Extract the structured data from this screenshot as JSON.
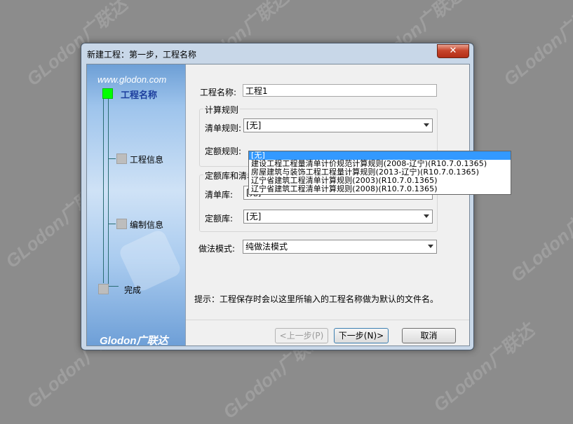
{
  "watermark": {
    "text": "GLodon广联达"
  },
  "dialog": {
    "title": "新建工程：第一步，工程名称",
    "close_symbol": "✕"
  },
  "sidebar": {
    "url": "www.glodon.com",
    "logo": "Glodon广联达",
    "steps": [
      {
        "label": "工程名称",
        "active": true
      },
      {
        "label": "工程信息",
        "active": false
      },
      {
        "label": "编制信息",
        "active": false
      },
      {
        "label": "完成",
        "active": false
      }
    ]
  },
  "form": {
    "project_name_label": "工程名称:",
    "project_name_value": "工程1",
    "calc_rules_group": "计算规则",
    "list_rule_label": "清单规则:",
    "list_rule_value": "[无]",
    "quota_rule_label": "定额规则:",
    "library_group": "定额库和清单库",
    "list_lib_label": "清单库:",
    "list_lib_value": "[无]",
    "quota_lib_label": "定额库:",
    "quota_lib_value": "[无]",
    "mode_label": "做法模式:",
    "mode_value": "纯做法模式"
  },
  "dropdown": {
    "options": [
      "[无]",
      "建设工程工程量清单计价规范计算规则(2008-辽宁)(R10.7.0.1365)",
      "房屋建筑与装饰工程工程量计算规则(2013-辽宁)(R10.7.0.1365)",
      "辽宁省建筑工程清单计算规则(2003)(R10.7.0.1365)",
      "辽宁省建筑工程清单计算规则(2008)(R10.7.0.1365)"
    ],
    "selected_index": 0
  },
  "hint": "提示：工程保存时会以这里所输入的工程名称做为默认的文件名。",
  "buttons": {
    "prev": "<上一步(P)",
    "next": "下一步(N)>",
    "cancel": "取消"
  },
  "colors": {
    "active_step": "#00ff00",
    "selection": "#3399ff",
    "close_button": "#c7452c"
  }
}
